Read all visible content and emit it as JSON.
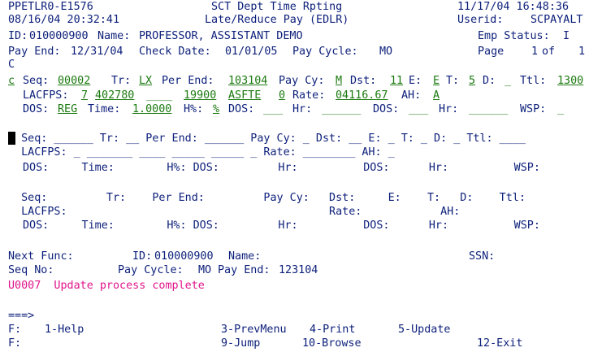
{
  "header": {
    "screen_id": "PPETLR0-E1576",
    "title1": "SCT Dept Time Rpting",
    "title2": "Late/Reduce Pay (EDLR)",
    "datetime1": "08/16/04 20:32:41",
    "datetime2": "11/17/04 16:48:36",
    "userid_label": "Userid:",
    "userid": "SCPAYALT",
    "id_label": "ID:",
    "id_value": "010000900",
    "name_label": "Name:",
    "name_value": "PROFESSOR, ASSISTANT DEMO",
    "emp_status_label": "Emp Status:",
    "emp_status_value": "I",
    "pay_end_label": "Pay End:",
    "pay_end_value": "12/31/04",
    "check_date_label": "Check Date:",
    "check_date_value": "01/01/05",
    "pay_cycle_label": "Pay Cycle:",
    "pay_cycle_value": "MO",
    "page_label": "Page",
    "page_value": "1",
    "of_label": "of",
    "page_total": "1",
    "c_line": "C"
  },
  "entry1": {
    "c": "c",
    "seq_label": "Seq:",
    "seq": "00002",
    "tr_label": "Tr:",
    "tr": "LX",
    "per_end_label": "Per End:",
    "per_end": "103104",
    "pay_cy_label": "Pay Cy:",
    "pay_cy": "M",
    "dst_label": "Dst:",
    "dst": "11",
    "e_label": "E:",
    "e": "E",
    "t_label": "T:",
    "t": "5",
    "d_label": "D:",
    "d": "_",
    "ttl_label": "Ttl:",
    "ttl": "1300",
    "lacfps_label": "LACFPS:",
    "lac1": "7",
    "lac2": "402780",
    "lac3": "____",
    "lac4": "19900",
    "lac5": "ASFTE",
    "lac6": "0",
    "rate_label": "Rate:",
    "rate": "04116.67",
    "ah_label": "AH:",
    "ah": "A",
    "dos_label": "DOS:",
    "dos": "REG",
    "time_label": "Time:",
    "time": "1.0000",
    "hpct_label": "H%:",
    "hpct": "%",
    "dos2_label": "DOS:",
    "dos2": "___",
    "hr_label": "Hr:",
    "hr": "______",
    "dos3_label": "DOS:",
    "dos3": "___",
    "hr2_label": "Hr:",
    "hr2": "______",
    "wsp_label": "WSP:",
    "wsp": "_"
  },
  "entry2": {
    "line1": "  Seq: ______ Tr: __ Per End: ______ Pay Cy: _ Dst: __ E: _ T: _ D: _ Ttl: ____",
    "line2": "  LACFPS: _ _______ ____ _____ _____ _ Rate: ________ AH: _",
    "line3": "DOS:     Time:        H%: DOS:         Hr:          DOS:      Hr:          WSP:"
  },
  "entry3": {
    "line1": "  Seq:         Tr:    Per End:         Pay Cy:   Dst:     E:    T:   D:    Ttl:",
    "line2": "  LACFPS:                                        Rate:            AH:",
    "line3": "DOS:     Time:        H%: DOS:         Hr:          DOS:      Hr:          WSP:"
  },
  "footer": {
    "next_func_label": "Next Func:",
    "id_label": "ID:",
    "id_value": "010000900",
    "name_label": "Name:",
    "ssn_label": "SSN:",
    "seq_no_label": "Seq No:",
    "pay_cycle_label": "Pay Cycle:",
    "pay_cycle_value": "MO",
    "pay_end_label": "Pay End:",
    "pay_end_value": "123104",
    "message": "U0007  Update process complete",
    "prompt": "===>",
    "f_label1": "F:",
    "f_label2": "F:",
    "pf1": "1-Help",
    "pf3": "3-PrevMenu",
    "pf4": "4-Print",
    "pf5": "5-Update",
    "pf9": "9-Jump",
    "pf10": "10-Browse",
    "pf12": "12-Exit"
  },
  "colors": {
    "label": "#0c1f7a",
    "input": "#1c7a10",
    "message": "#e0148a"
  }
}
